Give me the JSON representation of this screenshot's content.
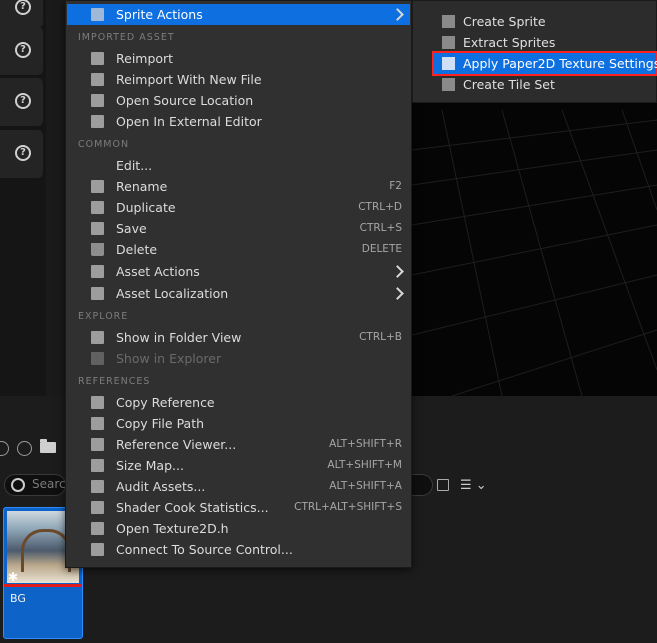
{
  "context_menu": {
    "sprite_actions": "Sprite Actions",
    "sections": {
      "imported_asset": "IMPORTED ASSET",
      "common": "COMMON",
      "explore": "EXPLORE",
      "references": "REFERENCES"
    },
    "imported_asset": [
      {
        "label": "Reimport",
        "icon": "reimport-icon"
      },
      {
        "label": "Reimport With New File",
        "icon": "reimport-new-file-icon"
      },
      {
        "label": "Open Source Location",
        "icon": "folder-open-icon"
      },
      {
        "label": "Open In External Editor",
        "icon": "external-editor-icon"
      }
    ],
    "common": [
      {
        "label": "Edit...",
        "shortcut": "",
        "icon": "edit-icon"
      },
      {
        "label": "Rename",
        "shortcut": "F2",
        "icon": "rename-icon"
      },
      {
        "label": "Duplicate",
        "shortcut": "CTRL+D",
        "icon": "duplicate-icon"
      },
      {
        "label": "Save",
        "shortcut": "CTRL+S",
        "icon": "save-icon"
      },
      {
        "label": "Delete",
        "shortcut": "DELETE",
        "icon": "trash-icon"
      },
      {
        "label": "Asset Actions",
        "shortcut": "",
        "icon": "wrench-icon"
      },
      {
        "label": "Asset Localization",
        "shortcut": "",
        "icon": "flag-icon"
      }
    ],
    "explore": [
      {
        "label": "Show in Folder View",
        "shortcut": "CTRL+B",
        "icon": "folder-view-icon"
      },
      {
        "label": "Show in Explorer",
        "shortcut": "",
        "icon": "explorer-icon"
      }
    ],
    "references": [
      {
        "label": "Copy Reference",
        "shortcut": "",
        "icon": "copy-reference-icon"
      },
      {
        "label": "Copy File Path",
        "shortcut": "",
        "icon": "copy-path-icon"
      },
      {
        "label": "Reference Viewer...",
        "shortcut": "ALT+SHIFT+R",
        "icon": "reference-viewer-icon"
      },
      {
        "label": "Size Map...",
        "shortcut": "ALT+SHIFT+M",
        "icon": "size-map-icon"
      },
      {
        "label": "Audit Assets...",
        "shortcut": "ALT+SHIFT+A",
        "icon": "audit-icon"
      },
      {
        "label": "Shader Cook Statistics...",
        "shortcut": "CTRL+ALT+SHIFT+S",
        "icon": "shader-stats-icon"
      },
      {
        "label": "Open Texture2D.h",
        "shortcut": "",
        "icon": "cpp-header-icon"
      },
      {
        "label": "Connect To Source Control...",
        "shortcut": "",
        "icon": "source-control-icon"
      }
    ]
  },
  "submenu": {
    "items": [
      {
        "label": "Create Sprite",
        "icon": "sprite-icon"
      },
      {
        "label": "Extract Sprites",
        "icon": "extract-sprites-icon"
      },
      {
        "label": "Apply Paper2D Texture Settings",
        "icon": "paper2d-settings-icon"
      },
      {
        "label": "Create Tile Set",
        "icon": "tile-set-icon"
      }
    ]
  },
  "content_browser": {
    "search_placeholder": "Searc",
    "asset_name": "BG"
  },
  "colors": {
    "highlight": "#0d6fe0",
    "selection_outline": "#ff2020",
    "menu_bg": "#303030",
    "asset_tile": "#0d63c8"
  }
}
